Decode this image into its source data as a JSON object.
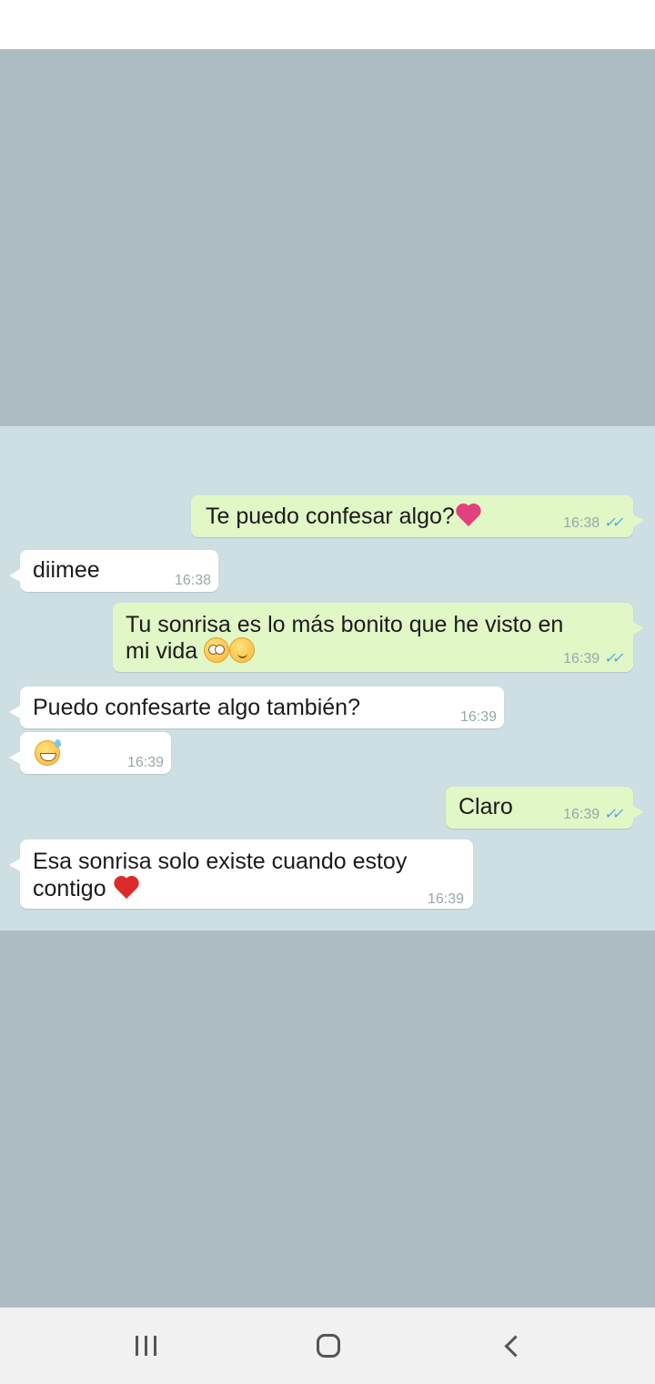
{
  "messages": [
    {
      "id": "m1",
      "direction": "outgoing",
      "text": "Te puedo confesar algo?",
      "emoji": "pink-heart",
      "time": "16:38",
      "read": true
    },
    {
      "id": "m2",
      "direction": "incoming",
      "text": "diimee",
      "time": "16:38"
    },
    {
      "id": "m3",
      "direction": "outgoing",
      "lines": [
        "Tu sonrisa es lo más bonito que he visto en",
        "mi vida"
      ],
      "emoji": [
        "flushed-face",
        "relieved-face"
      ],
      "time": "16:39",
      "read": true
    },
    {
      "id": "m4",
      "direction": "incoming",
      "text": "Puedo confesarte algo también?",
      "time": "16:39"
    },
    {
      "id": "m5",
      "direction": "incoming",
      "emoji": "grinning-sweat-face",
      "time": "16:39"
    },
    {
      "id": "m6",
      "direction": "outgoing",
      "text": "Claro",
      "time": "16:39",
      "read": true
    },
    {
      "id": "m7",
      "direction": "incoming",
      "lines": [
        "Esa sonrisa solo existe cuando estoy",
        "contigo"
      ],
      "emoji": "red-heart",
      "time": "16:39"
    }
  ],
  "colors": {
    "outgoing_bubble": "#e1f7c6",
    "incoming_bubble": "#ffffff",
    "chat_background": "#cddfe3",
    "read_ticks": "#4fa6e0",
    "outer_panel": "#adbcc2"
  },
  "nav": {
    "recents": "recents-icon",
    "home": "home-icon",
    "back": "back-icon"
  }
}
